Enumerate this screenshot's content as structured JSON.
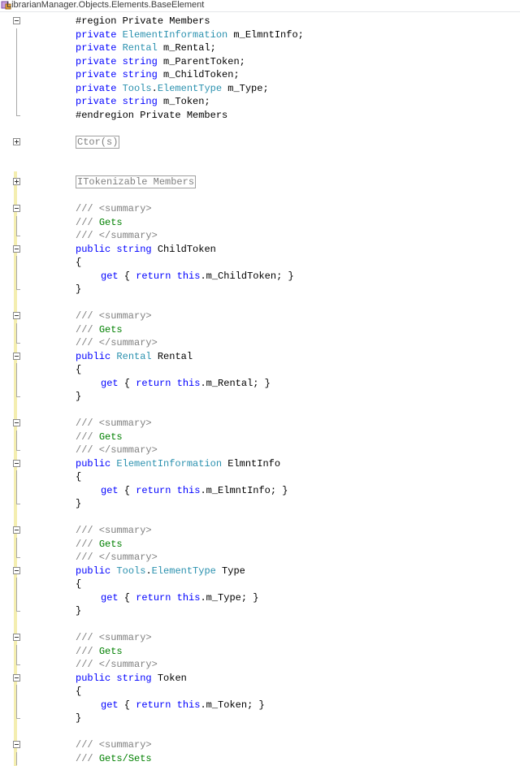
{
  "window": {
    "title": "LibrarianManager.Objects.Elements.BaseElement",
    "title_icon": "class-icon"
  },
  "colors": {
    "keyword": "#0000ff",
    "type": "#2b91af",
    "comment": "#008000",
    "doc_tag": "#808080",
    "changed_margin": "#f4eeb0"
  },
  "code": [
    {
      "text": "#region Private Members"
    },
    {
      "parts": [
        {
          "t": "private ",
          "c": "kw"
        },
        {
          "t": "ElementInformation",
          "c": "type"
        },
        {
          "t": " m_ElmntInfo;"
        }
      ]
    },
    {
      "parts": [
        {
          "t": "private ",
          "c": "kw"
        },
        {
          "t": "Rental",
          "c": "type"
        },
        {
          "t": " m_Rental;"
        }
      ]
    },
    {
      "parts": [
        {
          "t": "private ",
          "c": "kw"
        },
        {
          "t": "string",
          "c": "kw"
        },
        {
          "t": " m_ParentToken;"
        }
      ]
    },
    {
      "parts": [
        {
          "t": "private ",
          "c": "kw"
        },
        {
          "t": "string",
          "c": "kw"
        },
        {
          "t": " m_ChildToken;"
        }
      ]
    },
    {
      "parts": [
        {
          "t": "private ",
          "c": "kw"
        },
        {
          "t": "Tools",
          "c": "type"
        },
        {
          "t": "."
        },
        {
          "t": "ElementType",
          "c": "type"
        },
        {
          "t": " m_Type;"
        }
      ]
    },
    {
      "parts": [
        {
          "t": "private ",
          "c": "kw"
        },
        {
          "t": "string",
          "c": "kw"
        },
        {
          "t": " m_Token;"
        }
      ]
    },
    {
      "text": "#endregion Private Members"
    },
    {
      "text": ""
    },
    {
      "collapsed": "Ctor(s)"
    },
    {
      "text": ""
    },
    {
      "text": ""
    },
    {
      "collapsed": "ITokenizable Members"
    },
    {
      "text": ""
    },
    {
      "doc": "/// <summary>"
    },
    {
      "parts": [
        {
          "t": "/// ",
          "c": "doc"
        },
        {
          "t": "Gets",
          "c": "cm"
        }
      ]
    },
    {
      "doc": "/// </summary>"
    },
    {
      "parts": [
        {
          "t": "public ",
          "c": "kw"
        },
        {
          "t": "string",
          "c": "kw"
        },
        {
          "t": " ChildToken"
        }
      ]
    },
    {
      "text": "{"
    },
    {
      "indent": true,
      "parts": [
        {
          "t": "get",
          "c": "kw"
        },
        {
          "t": " { "
        },
        {
          "t": "return ",
          "c": "kw"
        },
        {
          "t": "this",
          "c": "kw"
        },
        {
          "t": ".m_ChildToken; }"
        }
      ]
    },
    {
      "text": "}"
    },
    {
      "text": ""
    },
    {
      "doc": "/// <summary>"
    },
    {
      "parts": [
        {
          "t": "/// ",
          "c": "doc"
        },
        {
          "t": "Gets",
          "c": "cm"
        }
      ]
    },
    {
      "doc": "/// </summary>"
    },
    {
      "parts": [
        {
          "t": "public ",
          "c": "kw"
        },
        {
          "t": "Rental",
          "c": "type"
        },
        {
          "t": " Rental"
        }
      ]
    },
    {
      "text": "{"
    },
    {
      "indent": true,
      "parts": [
        {
          "t": "get",
          "c": "kw"
        },
        {
          "t": " { "
        },
        {
          "t": "return ",
          "c": "kw"
        },
        {
          "t": "this",
          "c": "kw"
        },
        {
          "t": ".m_Rental; }"
        }
      ]
    },
    {
      "text": "}"
    },
    {
      "text": ""
    },
    {
      "doc": "/// <summary>"
    },
    {
      "parts": [
        {
          "t": "/// ",
          "c": "doc"
        },
        {
          "t": "Gets",
          "c": "cm"
        }
      ]
    },
    {
      "doc": "/// </summary>"
    },
    {
      "parts": [
        {
          "t": "public ",
          "c": "kw"
        },
        {
          "t": "ElementInformation",
          "c": "type"
        },
        {
          "t": " ElmntInfo"
        }
      ]
    },
    {
      "text": "{"
    },
    {
      "indent": true,
      "parts": [
        {
          "t": "get",
          "c": "kw"
        },
        {
          "t": " { "
        },
        {
          "t": "return ",
          "c": "kw"
        },
        {
          "t": "this",
          "c": "kw"
        },
        {
          "t": ".m_ElmntInfo; }"
        }
      ]
    },
    {
      "text": "}"
    },
    {
      "text": ""
    },
    {
      "doc": "/// <summary>"
    },
    {
      "parts": [
        {
          "t": "/// ",
          "c": "doc"
        },
        {
          "t": "Gets",
          "c": "cm"
        }
      ]
    },
    {
      "doc": "/// </summary>"
    },
    {
      "parts": [
        {
          "t": "public ",
          "c": "kw"
        },
        {
          "t": "Tools",
          "c": "type"
        },
        {
          "t": "."
        },
        {
          "t": "ElementType",
          "c": "type"
        },
        {
          "t": " Type"
        }
      ]
    },
    {
      "text": "{"
    },
    {
      "indent": true,
      "parts": [
        {
          "t": "get",
          "c": "kw"
        },
        {
          "t": " { "
        },
        {
          "t": "return ",
          "c": "kw"
        },
        {
          "t": "this",
          "c": "kw"
        },
        {
          "t": ".m_Type; }"
        }
      ]
    },
    {
      "text": "}"
    },
    {
      "text": ""
    },
    {
      "doc": "/// <summary>"
    },
    {
      "parts": [
        {
          "t": "/// ",
          "c": "doc"
        },
        {
          "t": "Gets",
          "c": "cm"
        }
      ]
    },
    {
      "doc": "/// </summary>"
    },
    {
      "parts": [
        {
          "t": "public ",
          "c": "kw"
        },
        {
          "t": "string",
          "c": "kw"
        },
        {
          "t": " Token"
        }
      ]
    },
    {
      "text": "{"
    },
    {
      "indent": true,
      "parts": [
        {
          "t": "get",
          "c": "kw"
        },
        {
          "t": " { "
        },
        {
          "t": "return ",
          "c": "kw"
        },
        {
          "t": "this",
          "c": "kw"
        },
        {
          "t": ".m_Token; }"
        }
      ]
    },
    {
      "text": "}"
    },
    {
      "text": ""
    },
    {
      "doc": "/// <summary>"
    },
    {
      "parts": [
        {
          "t": "/// ",
          "c": "doc"
        },
        {
          "t": "Gets/Sets",
          "c": "cm"
        }
      ]
    }
  ]
}
